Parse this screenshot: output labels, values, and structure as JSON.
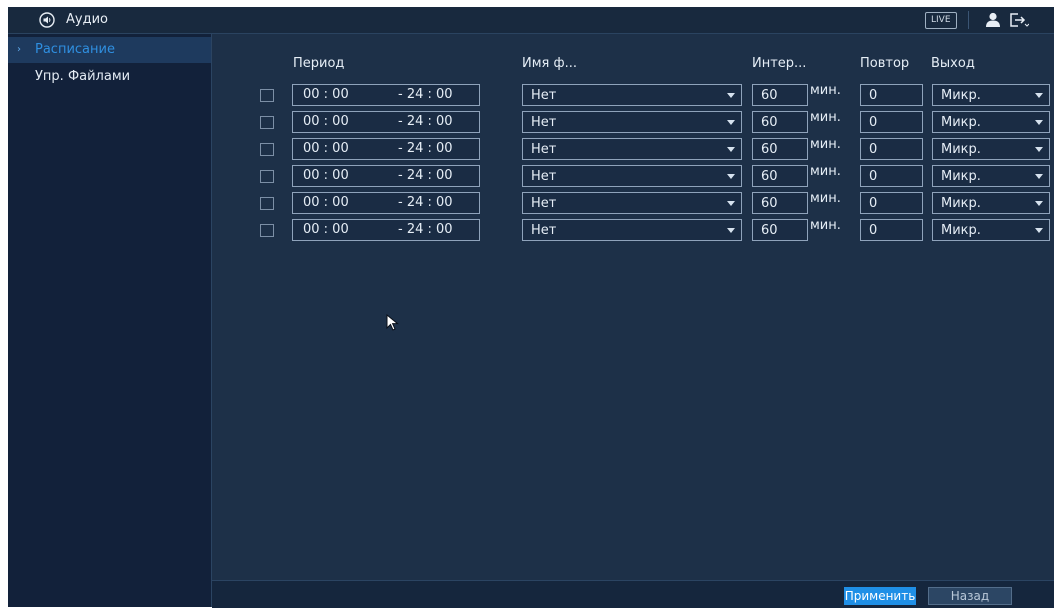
{
  "header": {
    "title": "Аудио",
    "live_label": "LIVE",
    "icons": [
      "speaker-icon",
      "user-icon",
      "logout-icon"
    ]
  },
  "sidebar": {
    "items": [
      {
        "label": "Расписание",
        "active": true
      },
      {
        "label": "Упр. Файлами",
        "active": false
      }
    ]
  },
  "table": {
    "headers": {
      "period": "Период",
      "file_name": "Имя ф...",
      "interval": "Интер...",
      "repeat": "Повтор",
      "output": "Выход"
    },
    "unit": "мин.",
    "rows": [
      {
        "checked": false,
        "start": "00 : 00",
        "end": "- 24 : 00",
        "file": "Нет",
        "interval": "60",
        "repeat": "0",
        "output": "Микр."
      },
      {
        "checked": false,
        "start": "00 : 00",
        "end": "- 24 : 00",
        "file": "Нет",
        "interval": "60",
        "repeat": "0",
        "output": "Микр."
      },
      {
        "checked": false,
        "start": "00 : 00",
        "end": "- 24 : 00",
        "file": "Нет",
        "interval": "60",
        "repeat": "0",
        "output": "Микр."
      },
      {
        "checked": false,
        "start": "00 : 00",
        "end": "- 24 : 00",
        "file": "Нет",
        "interval": "60",
        "repeat": "0",
        "output": "Микр."
      },
      {
        "checked": false,
        "start": "00 : 00",
        "end": "- 24 : 00",
        "file": "Нет",
        "interval": "60",
        "repeat": "0",
        "output": "Микр."
      },
      {
        "checked": false,
        "start": "00 : 00",
        "end": "- 24 : 00",
        "file": "Нет",
        "interval": "60",
        "repeat": "0",
        "output": "Микр."
      }
    ]
  },
  "footer": {
    "apply_label": "Применить",
    "back_label": "Назад"
  },
  "colors": {
    "background": "#1d3048",
    "sidebar": "#12213a",
    "accent": "#1f8fe6",
    "active_text": "#2f8fe0"
  }
}
